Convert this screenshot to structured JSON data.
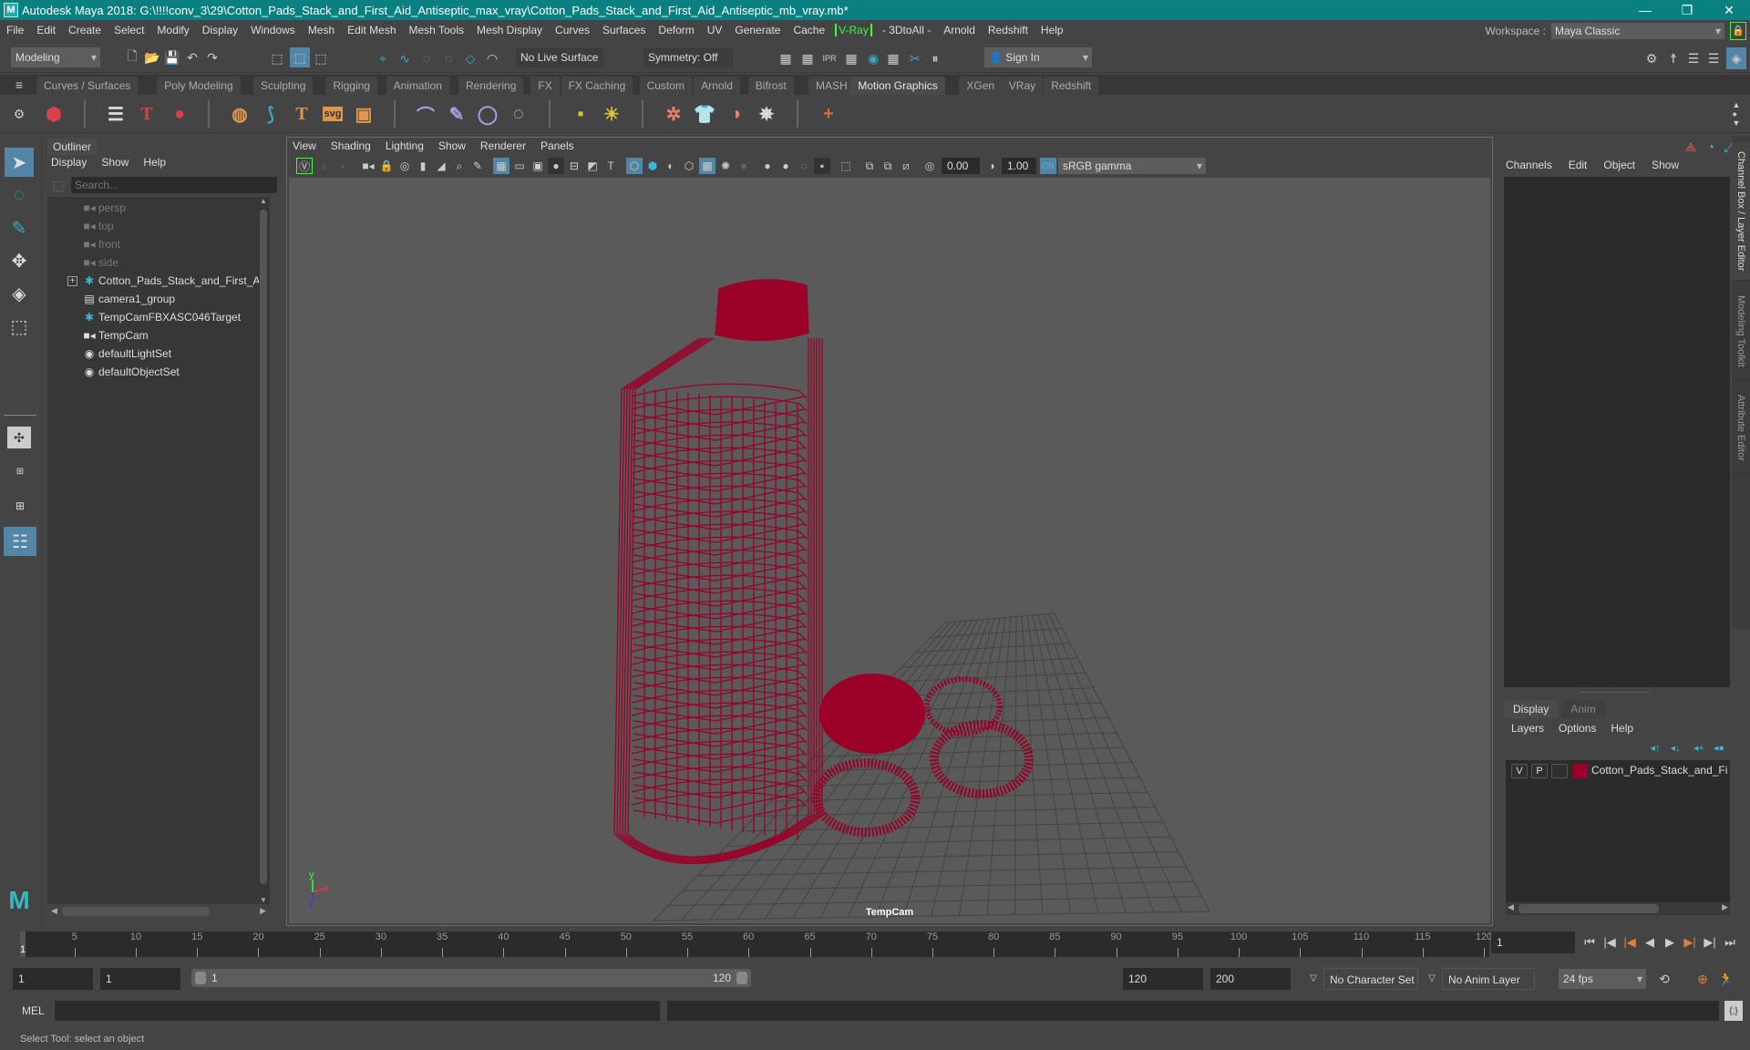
{
  "window": {
    "title": "Autodesk Maya 2018: G:\\!!!!conv_3\\29\\Cotton_Pads_Stack_and_First_Aid_Antiseptic_max_vray\\Cotton_Pads_Stack_and_First_Aid_Antiseptic_mb_vray.mb*",
    "controls": {
      "minimize": "—",
      "restore": "❐",
      "close": "✕"
    }
  },
  "menubar": {
    "items": [
      "File",
      "Edit",
      "Create",
      "Select",
      "Modify",
      "Display",
      "Windows",
      "Mesh",
      "Edit Mesh",
      "Mesh Tools",
      "Mesh Display",
      "Curves",
      "Surfaces",
      "Deform",
      "UV",
      "Generate",
      "Cache"
    ],
    "vray": "V-Ray",
    "items2": [
      "- 3DtoAll -",
      "Arnold",
      "Redshift",
      "Help"
    ],
    "workspace_label": "Workspace :",
    "workspace_value": "Maya Classic"
  },
  "statusline": {
    "mode": "Modeling",
    "live_surface": "No Live Surface",
    "symmetry": "Symmetry: Off",
    "sign_in": "Sign In"
  },
  "shelf": {
    "tabs": [
      "Curves / Surfaces",
      "Poly Modeling",
      "Sculpting",
      "Rigging",
      "Animation",
      "Rendering",
      "FX",
      "FX Caching",
      "Custom",
      "Arnold",
      "Bifrost",
      "MASH",
      "Motion Graphics",
      "XGen",
      "VRay",
      "Redshift"
    ],
    "active_tab": "Motion Graphics",
    "colors": {
      "red": "#d9404a",
      "orange": "#e0964a",
      "purple": "#a89ad8",
      "cyan": "#3aa8c0",
      "yellow": "#d8c23a"
    }
  },
  "outliner": {
    "title": "Outliner",
    "menus": [
      "Display",
      "Show",
      "Help"
    ],
    "search_placeholder": "Search...",
    "items": [
      {
        "label": "persp",
        "icon": "camera-icon",
        "dim": true
      },
      {
        "label": "top",
        "icon": "camera-icon",
        "dim": true
      },
      {
        "label": "front",
        "icon": "camera-icon",
        "dim": true
      },
      {
        "label": "side",
        "icon": "camera-icon",
        "dim": true
      },
      {
        "label": "Cotton_Pads_Stack_and_First_Aid_An",
        "icon": "transform-icon",
        "expandable": true
      },
      {
        "label": "camera1_group",
        "icon": "group-icon"
      },
      {
        "label": "TempCamFBXASC046Target",
        "icon": "transform-icon"
      },
      {
        "label": "TempCam",
        "icon": "camera-icon"
      },
      {
        "label": "defaultLightSet",
        "icon": "set-icon"
      },
      {
        "label": "defaultObjectSet",
        "icon": "set-icon"
      }
    ]
  },
  "viewport": {
    "menus": [
      "View",
      "Shading",
      "Lighting",
      "Show",
      "Renderer",
      "Panels"
    ],
    "exposure": "0.00",
    "gamma": "1.00",
    "color_space": "sRGB gamma",
    "camera_label": "TempCam",
    "wire_color": "#9a0028",
    "axis": {
      "x": "x",
      "y": "y",
      "z": "z"
    }
  },
  "channel_box": {
    "menus": [
      "Channels",
      "Edit",
      "Object",
      "Show"
    ]
  },
  "layer_editor": {
    "tabs": [
      "Display",
      "Anim"
    ],
    "menus": [
      "Layers",
      "Options",
      "Help"
    ],
    "layer": {
      "v": "V",
      "p": "P",
      "name": "Cotton_Pads_Stack_and_First_",
      "color": "#9a0028"
    }
  },
  "side_tabs": [
    "Channel Box / Layer Editor",
    "Modeling Toolkit",
    "Attribute Editor"
  ],
  "timeline": {
    "ticks": [
      5,
      10,
      15,
      20,
      25,
      30,
      35,
      40,
      45,
      50,
      55,
      60,
      65,
      70,
      75,
      80,
      85,
      90,
      95,
      100,
      105,
      110,
      115,
      120
    ],
    "current_frame_marker": "1",
    "current_frame": "1"
  },
  "range": {
    "start": "1",
    "playback_start": "1",
    "slider_start": "1",
    "slider_end": "120",
    "playback_end": "120",
    "end": "200",
    "character_set": "No Character Set",
    "anim_layer": "No Anim Layer",
    "fps": "24 fps"
  },
  "command": {
    "label": "MEL"
  },
  "help_line": "Select Tool: select an object"
}
